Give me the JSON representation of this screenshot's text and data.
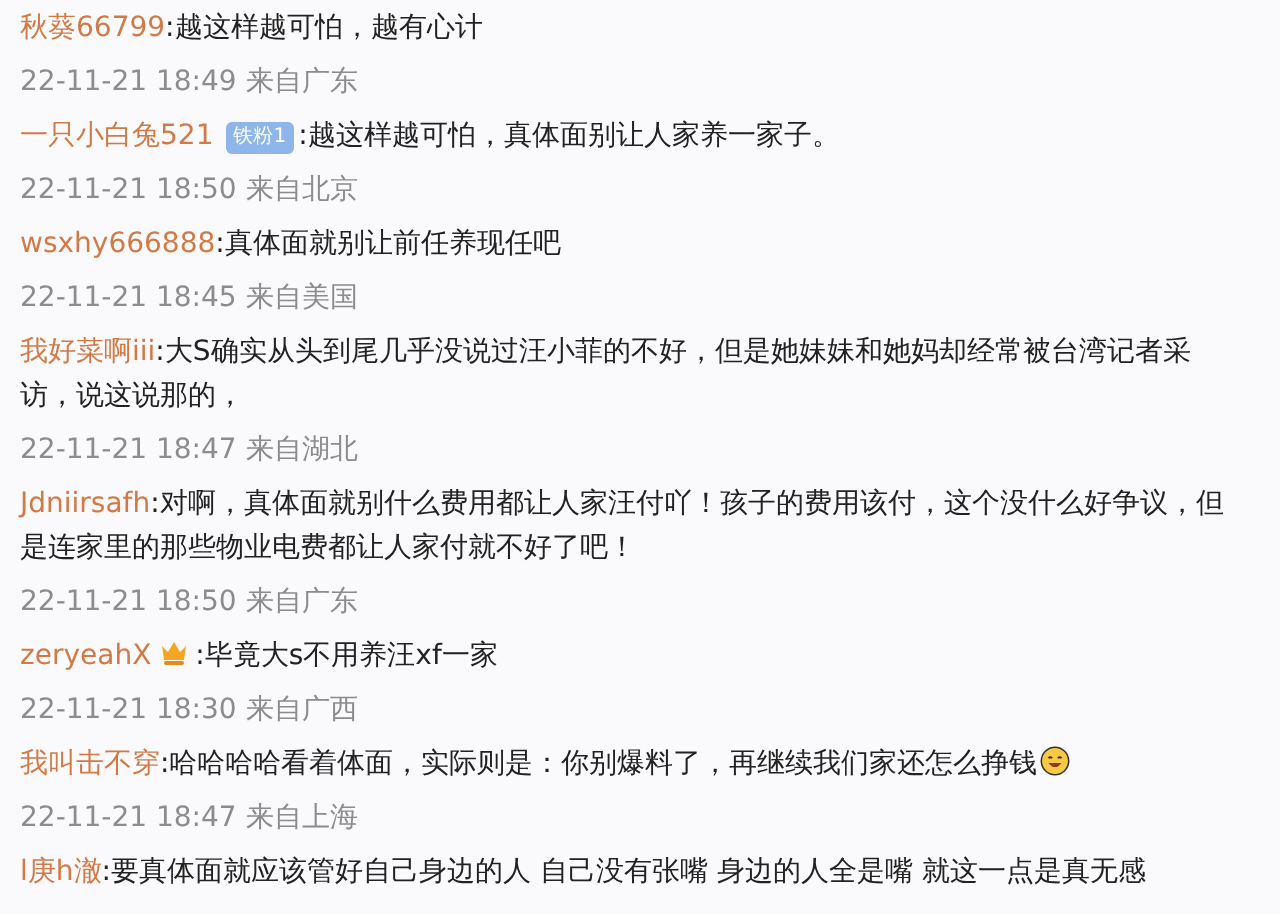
{
  "comments": [
    {
      "user": "秋葵66799",
      "text": ":越这样越可怕，越有心计",
      "time": "22-11-21 18:49 来自广东"
    },
    {
      "user": "一只小白兔521",
      "badge": "铁粉1",
      "text": ":越这样越可怕，真体面别让人家养一家子。",
      "time": "22-11-21 18:50 来自北京"
    },
    {
      "user": "wsxhy666888",
      "text": ":真体面就别让前任养现任吧",
      "time": "22-11-21 18:45 来自美国"
    },
    {
      "user": "我好菜啊iii",
      "text": ":大S确实从头到尾几乎没说过汪小菲的不好，但是她妹妹和她妈却经常被台湾记者采访，说这说那的，",
      "time": "22-11-21 18:47 来自湖北"
    },
    {
      "user": "Jdniirsafh",
      "text": ":对啊，真体面就别什么费用都让人家汪付吖！孩子的费用该付，这个没什么好争议，但是连家里的那些物业电费都让人家付就不好了吧！",
      "time": "22-11-21 18:50 来自广东"
    },
    {
      "user": "zeryeahX",
      "crown": true,
      "text": ":毕竟大s不用养汪xf一家",
      "time": "22-11-21 18:30 来自广西"
    },
    {
      "user": "我叫击不穿",
      "text": ":哈哈哈哈看着体面，实际则是：你别爆料了，再继续我们家还怎么挣钱",
      "emoji": true,
      "time": "22-11-21 18:47 来自上海"
    },
    {
      "user": "l庚h澈",
      "text": ":要真体面就应该管好自己身边的人  自己没有张嘴 身边的人全是嘴 就这一点是真无感"
    }
  ]
}
